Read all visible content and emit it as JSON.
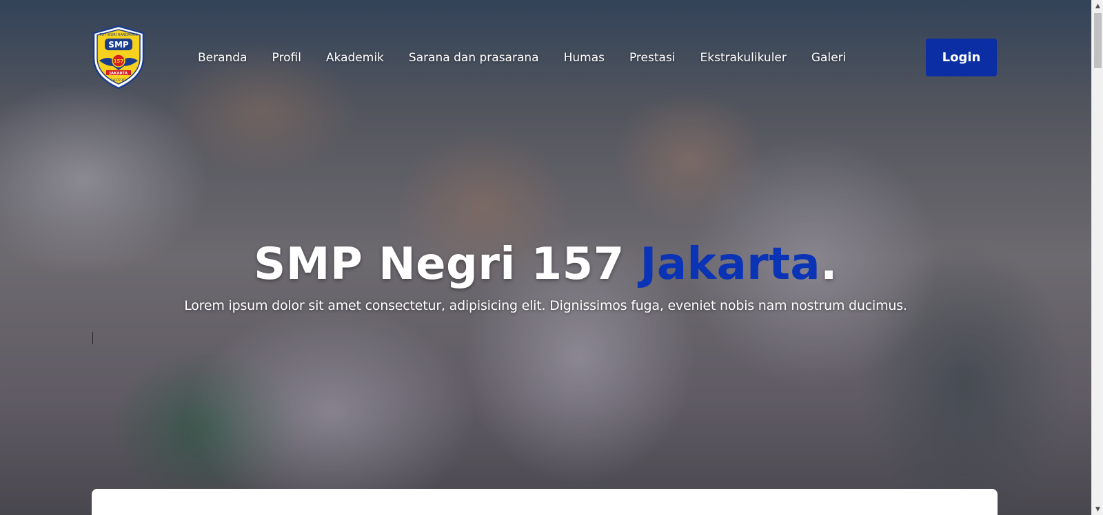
{
  "navbar": {
    "logo": {
      "icon": "school-emblem-icon",
      "top_text": "TUT WURI HANDAYANI",
      "badge_text": "SMP",
      "number": "157",
      "city": "JAKARTA",
      "date": "14-07-81"
    },
    "menu": [
      {
        "label": "Beranda"
      },
      {
        "label": "Profil"
      },
      {
        "label": "Akademik"
      },
      {
        "label": "Sarana dan prasarana"
      },
      {
        "label": "Humas"
      },
      {
        "label": "Prestasi"
      },
      {
        "label": "Ekstrakulikuler"
      },
      {
        "label": "Galeri"
      }
    ],
    "login_label": "Login"
  },
  "hero": {
    "title_main": "SMP Negri 157 ",
    "title_accent": "Jakarta",
    "title_end": ".",
    "subtitle": "Lorem ipsum dolor sit amet consectetur, adipisicing elit. Dignissimos fuga, eveniet nobis nam nostrum ducimus."
  },
  "colors": {
    "accent": "#0b33b5",
    "login_button": "#0b2ea5",
    "text": "#ffffff"
  },
  "scrollbar": {
    "up_icon": "chevron-up-icon",
    "down_icon": "chevron-down-icon"
  }
}
